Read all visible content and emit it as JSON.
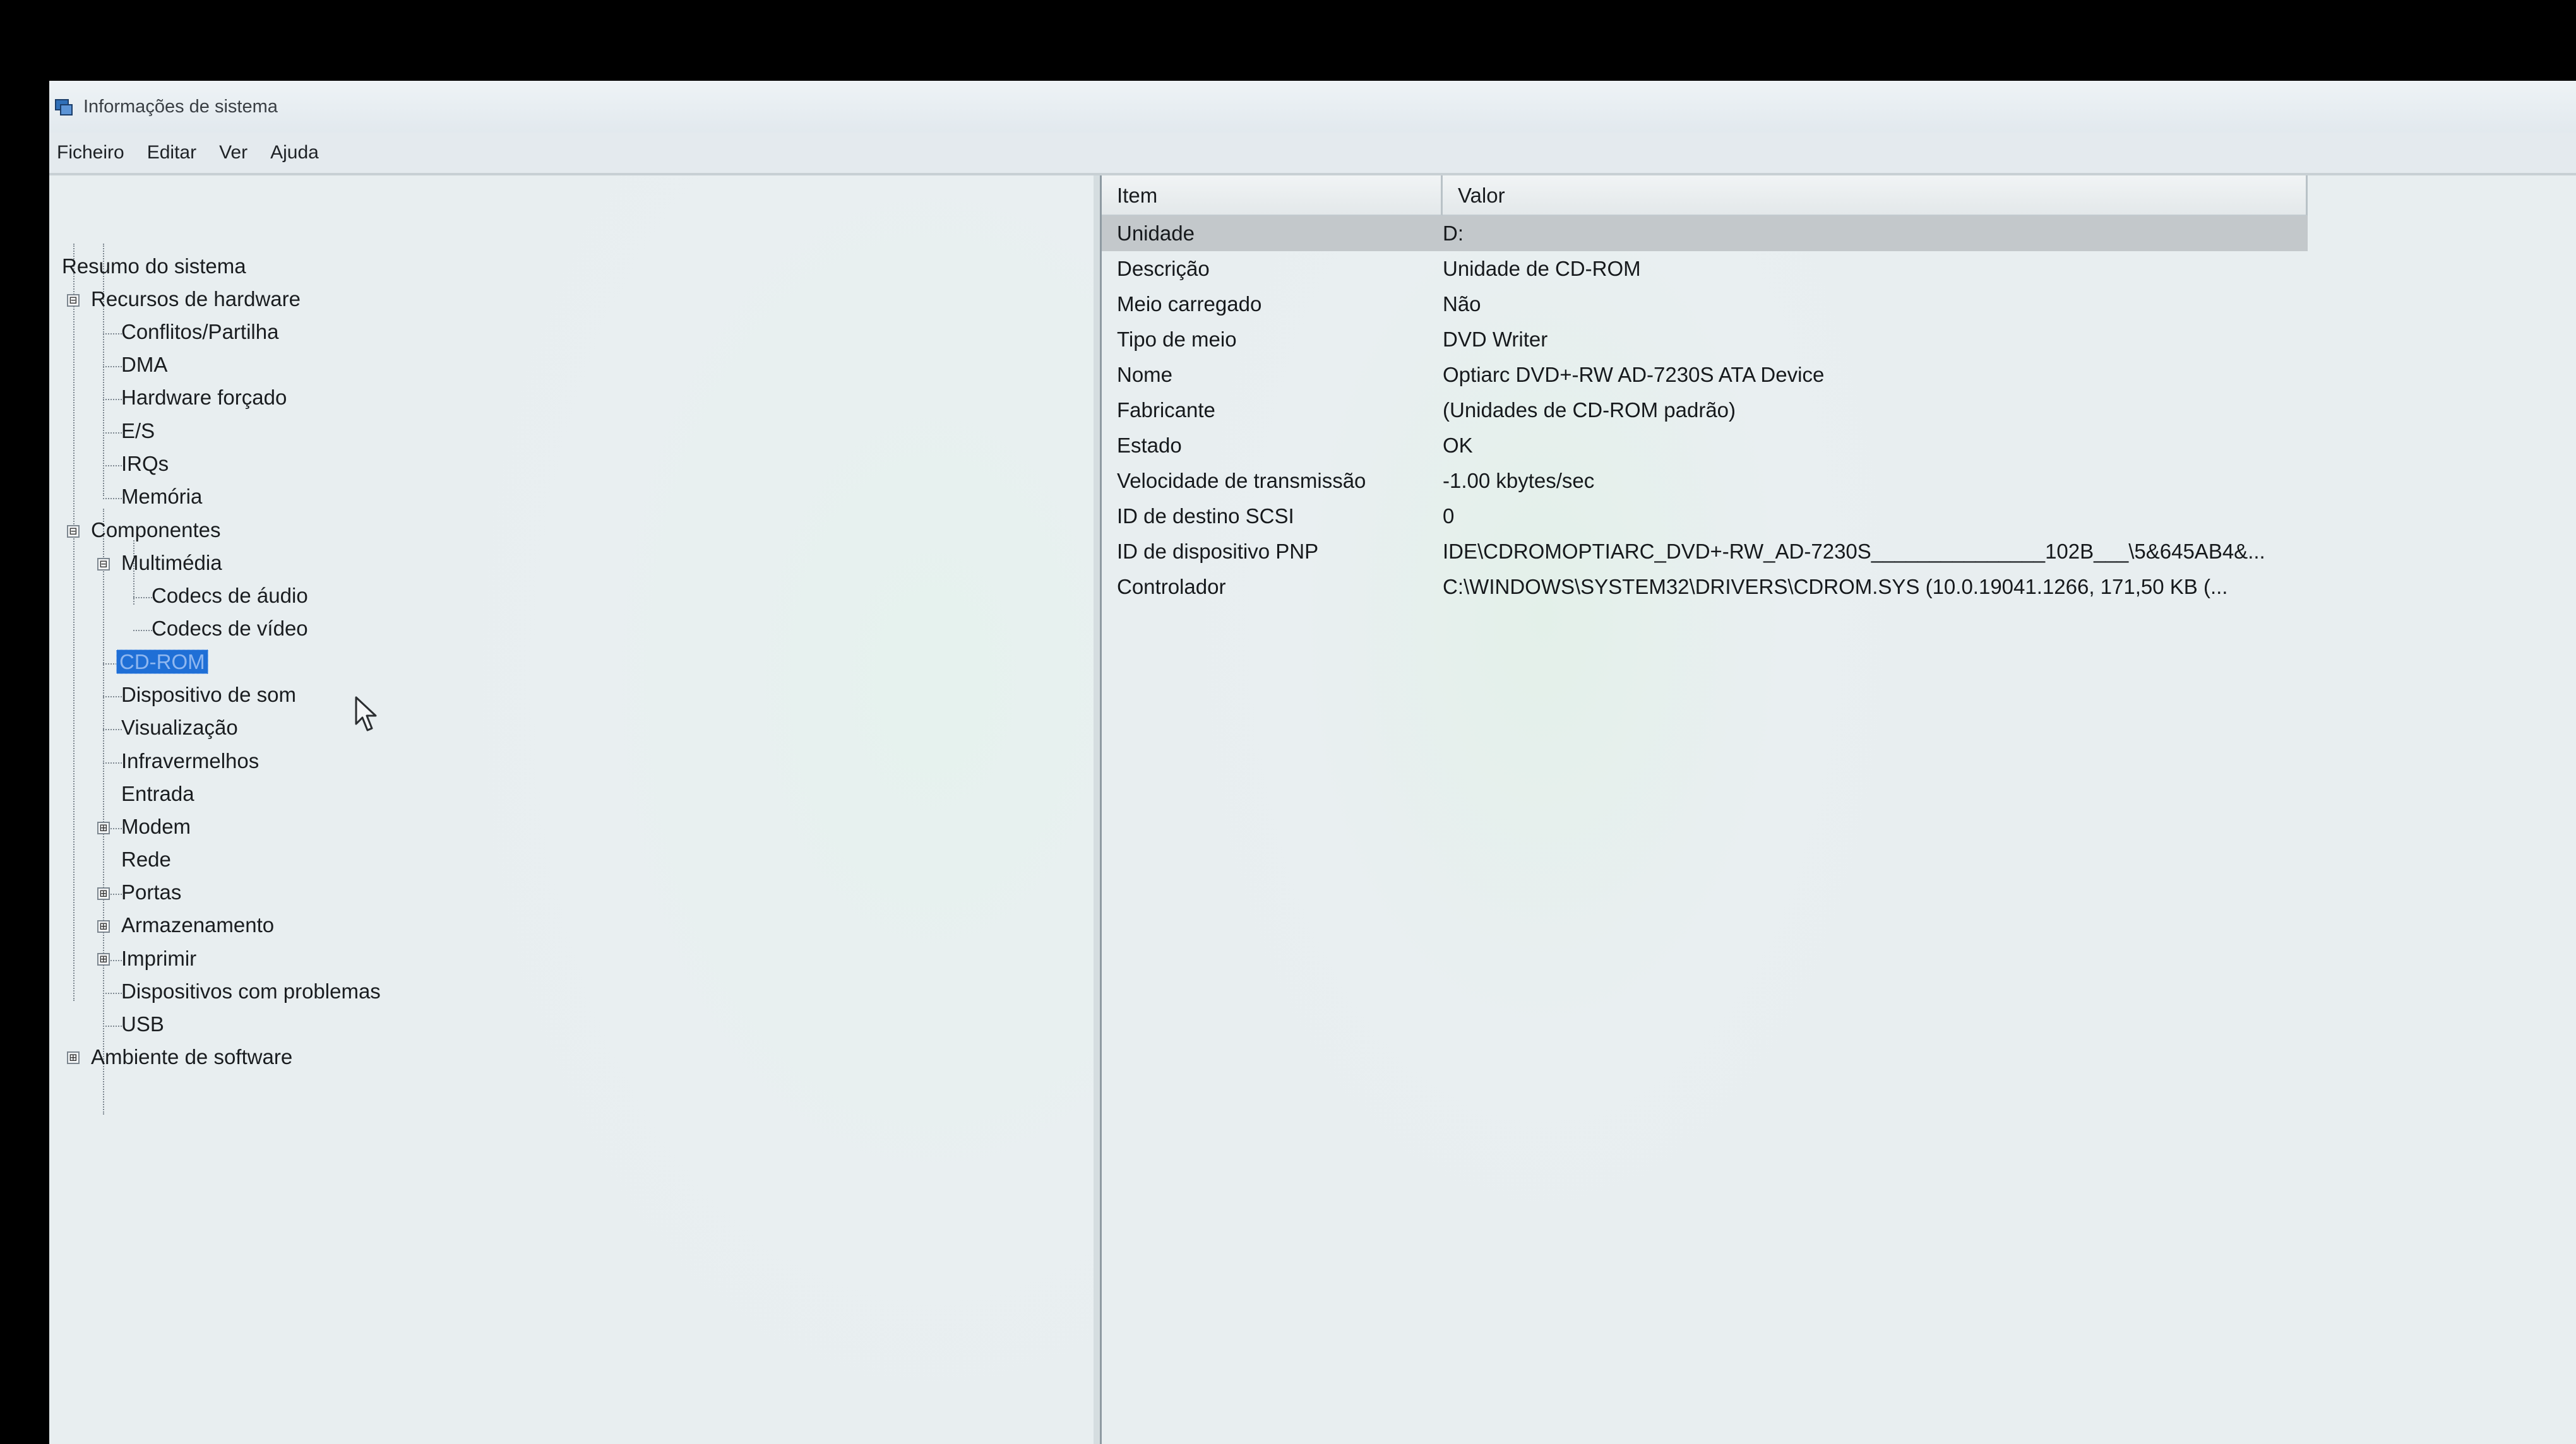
{
  "window": {
    "title": "Informações de sistema",
    "icon": "system-information-icon"
  },
  "menu": [
    "Ficheiro",
    "Editar",
    "Ver",
    "Ajuda"
  ],
  "tree": {
    "root": "Resumo do sistema",
    "hardware_resources": {
      "label": "Recursos de hardware",
      "expander": "⊟",
      "children": [
        "Conflitos/Partilha",
        "DMA",
        "Hardware forçado",
        "E/S",
        "IRQs",
        "Memória"
      ]
    },
    "components": {
      "label": "Componentes",
      "expander": "⊟",
      "multimedia": {
        "label": "Multimédia",
        "expander": "⊟",
        "children": [
          "Codecs de áudio",
          "Codecs de vídeo"
        ]
      },
      "items": [
        {
          "label": "CD-ROM",
          "selected": true
        },
        {
          "label": "Dispositivo de som"
        },
        {
          "label": "Visualização"
        },
        {
          "label": "Infravermelhos"
        },
        {
          "label": "Entrada",
          "expander": "⊞"
        },
        {
          "label": "Modem"
        },
        {
          "label": "Rede",
          "expander": "⊞"
        },
        {
          "label": "Portas",
          "expander": "⊞"
        },
        {
          "label": "Armazenamento",
          "expander": "⊞"
        },
        {
          "label": "Imprimir"
        },
        {
          "label": "Dispositivos com problemas"
        },
        {
          "label": "USB"
        }
      ]
    },
    "software_environment": {
      "label": "Ambiente de software",
      "expander": "⊞"
    }
  },
  "table": {
    "columns": [
      "Item",
      "Valor"
    ],
    "rows": [
      {
        "item": "Unidade",
        "value": "D:"
      },
      {
        "item": "Descrição",
        "value": "Unidade de CD-ROM"
      },
      {
        "item": "Meio carregado",
        "value": "Não"
      },
      {
        "item": "Tipo de meio",
        "value": "DVD Writer"
      },
      {
        "item": "Nome",
        "value": "Optiarc DVD+-RW AD-7230S ATA Device"
      },
      {
        "item": "Fabricante",
        "value": "(Unidades de CD-ROM padrão)"
      },
      {
        "item": "Estado",
        "value": "OK"
      },
      {
        "item": "Velocidade de transmissão",
        "value": "-1.00 kbytes/sec"
      },
      {
        "item": "ID de destino SCSI",
        "value": "0"
      },
      {
        "item": "ID de dispositivo PNP",
        "value": "IDE\\CDROMOPTIARC_DVD+-RW_AD-7230S_______________102B___\\5&645AB4&..."
      },
      {
        "item": "Controlador",
        "value": "C:\\WINDOWS\\SYSTEM32\\DRIVERS\\CDROM.SYS (10.0.19041.1266, 171,50 KB (..."
      }
    ]
  }
}
